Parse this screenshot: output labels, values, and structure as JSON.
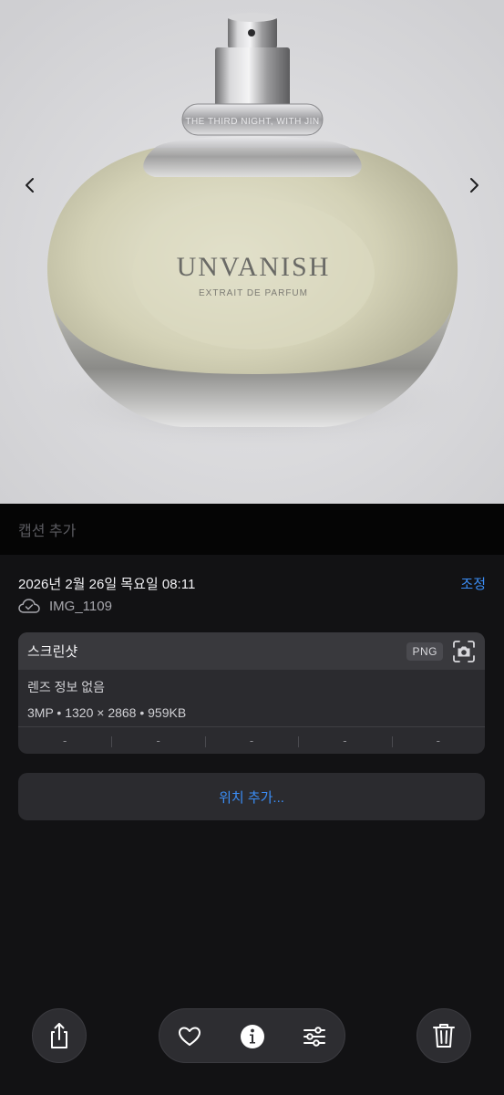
{
  "photo": {
    "ring_text": "THE THIRD NIGHT, WITH JIN",
    "brand": "UNVANISH",
    "subtitle": "EXTRAIT DE PARFUM",
    "prev_icon": "chevron-left-icon",
    "next_icon": "chevron-right-icon"
  },
  "caption": {
    "placeholder": "캡션 추가"
  },
  "info": {
    "date": "2026년 2월 26일 목요일 08:11",
    "adjust_label": "조정",
    "filename": "IMG_1109",
    "cloud_icon": "icloud-check-icon"
  },
  "card": {
    "title": "스크린샷",
    "badge": "PNG",
    "lens": "렌즈 정보 없음",
    "specs": "3MP  •  1320 × 2868  •  959KB",
    "exif": [
      "-",
      "-",
      "-",
      "-",
      "-"
    ]
  },
  "location": {
    "label": "위치 추가..."
  },
  "toolbar": {
    "share_icon": "share-icon",
    "favorite_icon": "heart-icon",
    "info_icon": "info-icon",
    "adjust_icon": "sliders-icon",
    "delete_icon": "trash-icon"
  },
  "colors": {
    "accent": "#3b8df5",
    "background": "#121214",
    "card": "#2b2b2f",
    "photo_bg": "#d7d7d9"
  }
}
